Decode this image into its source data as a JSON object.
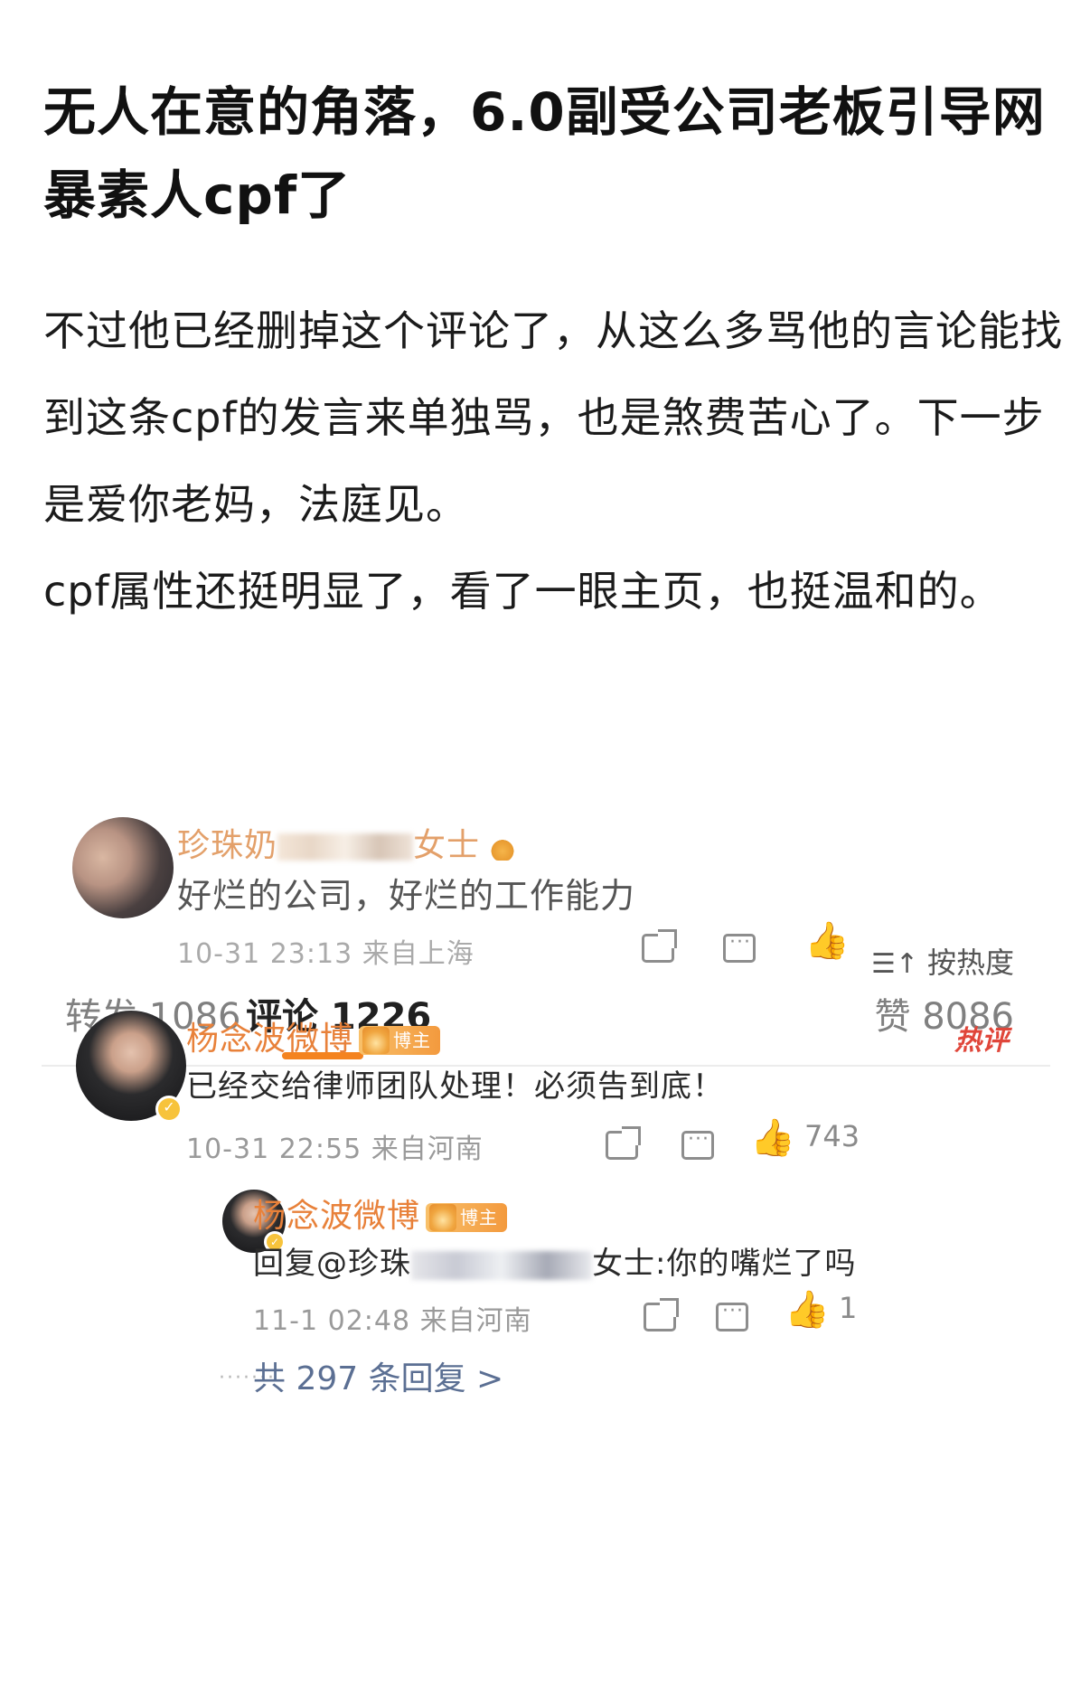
{
  "post": {
    "title": "无人在意的角落，6.0副受公司老板引导网暴素人cpf了",
    "body": [
      "不过他已经删掉这个评论了，从这么多骂他的言论能找到这条cpf的发言来单独骂，也是煞费苦心了。下一步是爱你老妈，法庭见。",
      "cpf属性还挺明显了，看了一眼主页，也挺温和的。"
    ]
  },
  "screenshot": {
    "origin_comment": {
      "username_prefix": "珍珠奶",
      "username_suffix": "女士",
      "text": "好烂的公司，好烂的工作能力",
      "time_location": "10-31 23:13 来自上海"
    },
    "tabs": {
      "repost": "转发 1086",
      "comments": "评论 1226",
      "likes": "赞 8086"
    },
    "sort_label": "按热度",
    "sort_icon": "sort-icon",
    "hot_comment": {
      "username": "杨念波微博",
      "badge": "博主",
      "hot_tag": "热评",
      "text": "已经交给律师团队处理！必须告到底！",
      "time_location": "10-31 22:55 来自河南",
      "like_count": "743"
    },
    "reply": {
      "username": "杨念波微博",
      "badge": "博主",
      "text_prefix": "回复@珍珠",
      "text_suffix": "女士:你的嘴烂了吗",
      "time_location": "11-1 02:48 来自河南",
      "like_count": "1"
    },
    "more_replies": "共 297 条回复 >",
    "icons": [
      "share-icon",
      "comment-icon",
      "like-icon",
      "crown-icon",
      "verified-icon"
    ]
  }
}
